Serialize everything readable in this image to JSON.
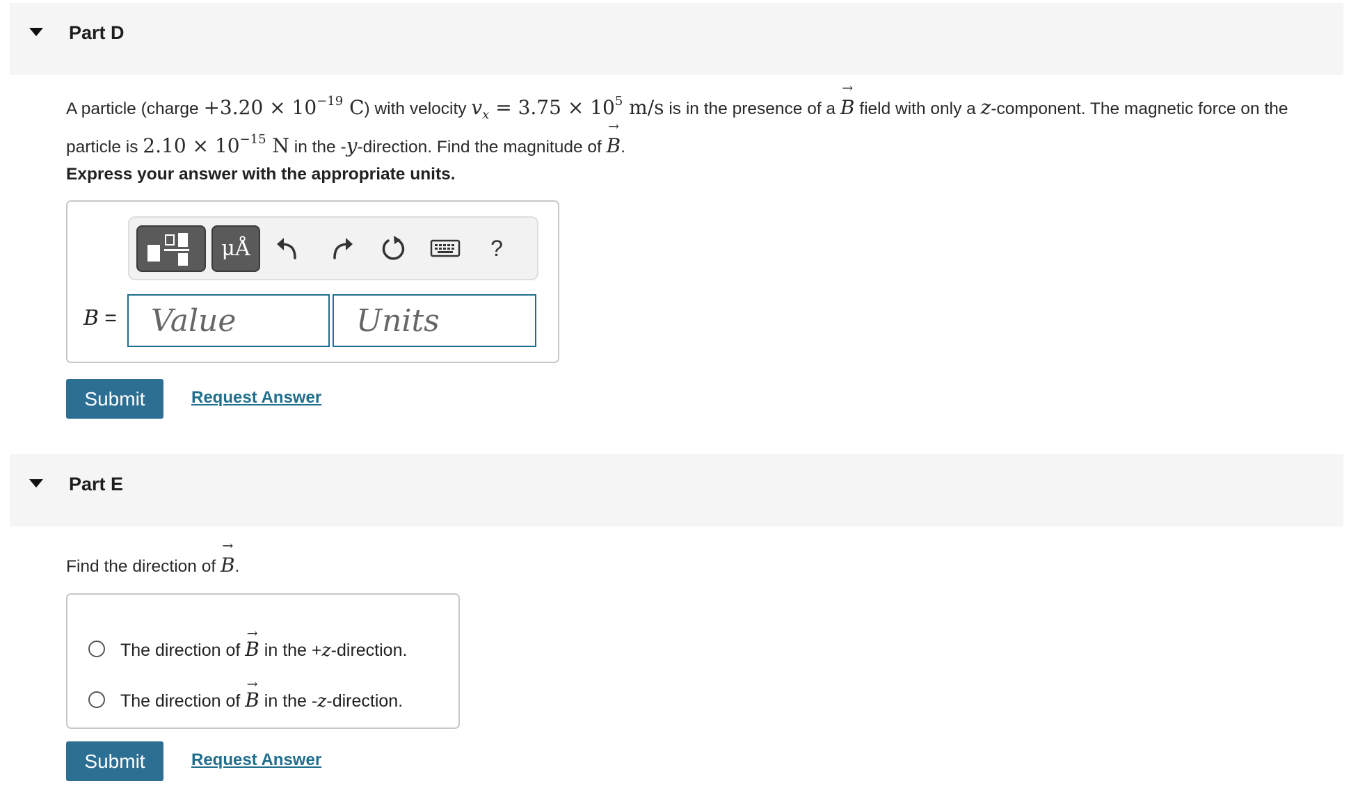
{
  "partD": {
    "title": "Part D",
    "q_a": "A particle (charge ",
    "q_charge": "+3.20 × 10",
    "q_charge_exp": "−19",
    "q_charge_unit": " C",
    "q_b": ") with velocity ",
    "q_v": "v",
    "q_v_sub": "x",
    "q_vel": " = 3.75 × 10",
    "q_vel_exp": "5",
    "q_vel_unit": " m/s",
    "q_c": " is in the presence of a ",
    "q_B": "B",
    "q_d": " field with only a ",
    "q_z": "z",
    "q_e": "-component. The magnetic force on the",
    "q_f": "particle is ",
    "q_force": "2.10 × 10",
    "q_force_exp": "−15",
    "q_force_unit": " N",
    "q_g": " in the -",
    "q_y": "y",
    "q_h": "-direction. Find the magnitude of ",
    "q_B2": "B",
    "q_i": ".",
    "express": "Express your answer with the appropriate units.",
    "toolbar": {
      "units_label": "μÅ",
      "help_label": "?"
    },
    "var_label": "B",
    "var_eq": " =",
    "value_placeholder": "Value",
    "units_placeholder": "Units",
    "submit_label": "Submit",
    "request_label": "Request Answer"
  },
  "partE": {
    "title": "Part E",
    "q_a": "Find the direction of ",
    "q_B": "B",
    "q_b": ".",
    "choices": [
      {
        "pre": "The direction of ",
        "sym": "B",
        "mid": " in the +",
        "axis": "z",
        "post": "-direction."
      },
      {
        "pre": "The direction of ",
        "sym": "B",
        "mid": " in the -",
        "axis": "z",
        "post": "-direction."
      }
    ],
    "submit_label": "Submit",
    "request_label": "Request Answer"
  },
  "icons": [
    "caret-down-icon",
    "fraction-template-icon",
    "units-template-icon",
    "undo-icon",
    "redo-icon",
    "reset-icon",
    "keyboard-icon",
    "help-icon"
  ]
}
